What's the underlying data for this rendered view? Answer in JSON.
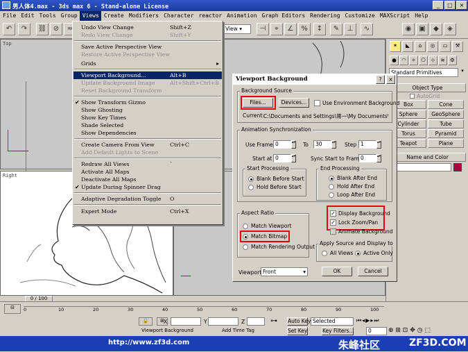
{
  "window": {
    "title": "男人体4.max - 3ds max 6 - Stand-alone License",
    "buttons": [
      "_",
      "□",
      "×"
    ]
  },
  "menubar": [
    "File",
    "Edit",
    "Tools",
    "Group",
    "Views",
    "Create",
    "Modifiers",
    "Character",
    "reactor",
    "Animation",
    "Graph Editors",
    "Rendering",
    "Customize",
    "MAXScript",
    "Help"
  ],
  "toolbar": {
    "view_select": "View"
  },
  "views_menu": {
    "items": [
      {
        "label": "Undo View Change",
        "shortcut": "Shift+Z",
        "state": "normal"
      },
      {
        "label": "Redo View Change",
        "shortcut": "Shift+Y",
        "state": "disabled"
      },
      {
        "label": "Save Active Perspective View",
        "shortcut": "",
        "state": "normal"
      },
      {
        "label": "Restore Active Perspective View",
        "shortcut": "",
        "state": "disabled"
      },
      {
        "label": "Grids",
        "shortcut": "",
        "state": "normal"
      },
      {
        "label": "Viewport Background...",
        "shortcut": "Alt+B",
        "state": "highlighted"
      },
      {
        "label": "Update Background Image",
        "shortcut": "Alt+Shift+Ctrl+B",
        "state": "disabled"
      },
      {
        "label": "Reset Background Transform",
        "shortcut": "",
        "state": "disabled"
      },
      {
        "label": "Show Transform Gizmo",
        "shortcut": "",
        "state": "checked"
      },
      {
        "label": "Show Ghosting",
        "shortcut": "",
        "state": "normal"
      },
      {
        "label": "Show Key Times",
        "shortcut": "",
        "state": "normal"
      },
      {
        "label": "Shade Selected",
        "shortcut": "",
        "state": "normal"
      },
      {
        "label": "Show Dependencies",
        "shortcut": "",
        "state": "normal"
      },
      {
        "label": "Create Camera From View",
        "shortcut": "Ctrl+C",
        "state": "normal"
      },
      {
        "label": "Add Default Lights to Scene",
        "shortcut": "",
        "state": "disabled"
      },
      {
        "label": "Redraw All Views",
        "shortcut": "`",
        "state": "normal"
      },
      {
        "label": "Activate All Maps",
        "shortcut": "",
        "state": "normal"
      },
      {
        "label": "Deactivate All Maps",
        "shortcut": "",
        "state": "normal"
      },
      {
        "label": "Update During Spinner Drag",
        "shortcut": "",
        "state": "checked"
      },
      {
        "label": "Adaptive Degradation Toggle",
        "shortcut": "O",
        "state": "normal"
      },
      {
        "label": "Expert Mode",
        "shortcut": "Ctrl+X",
        "state": "normal"
      }
    ]
  },
  "viewports": {
    "top": "Top",
    "left": "Right"
  },
  "command_panel": {
    "category": "Standard Primitives",
    "object_type": "Object Type",
    "autogrid": "AutoGrid",
    "buttons": [
      "Box",
      "Cone",
      "Sphere",
      "GeoSphere",
      "Cylinder",
      "Tube",
      "Torus",
      "Pyramid",
      "Teapot",
      "Plane"
    ],
    "name_color": "Name and Color"
  },
  "dialog": {
    "title": "Viewport Background",
    "help": "?",
    "close": "×",
    "background_source": {
      "group": "Background Source",
      "files_button": "Files...",
      "devices_button": "Devices...",
      "use_env_label": "Use Environment Background",
      "current_label": "Current:",
      "current_path": "C:\\Documents and Settings\\蒋一\\My Documents\\My"
    },
    "anim_sync": {
      "group": "Animation Synchronization",
      "use_frame_label": "Use Frame",
      "use_frame_value": "0",
      "to_label": "To",
      "to_value": "30",
      "step_label": "Step",
      "step_value": "1",
      "start_at_label": "Start at",
      "start_at_value": "0",
      "sync_label": "Sync Start to Frame",
      "sync_value": "0"
    },
    "start_processing": {
      "group": "Start Processing",
      "options": [
        "Blank Before Start",
        "Hold Before Start"
      ],
      "selected": 0
    },
    "end_processing": {
      "group": "End Processing",
      "options": [
        "Blank After End",
        "Hold After End",
        "Loop After End"
      ],
      "selected": 0
    },
    "aspect_ratio": {
      "group": "Aspect Ratio",
      "options": [
        "Match Viewport",
        "Match Bitmap",
        "Match Rendering Output"
      ],
      "selected": 1
    },
    "display_background": "Display Background",
    "lock_zoom_pan": "Lock Zoom/Pan",
    "animate_background": "Animate Background",
    "apply_source": {
      "group": "Apply Source and Display to",
      "options": [
        "All Views",
        "Active Only"
      ],
      "selected": 1
    },
    "viewport_label": "Viewport:",
    "viewport_value": "Front",
    "ok": "OK",
    "cancel": "Cancel"
  },
  "timeline": {
    "frame_display": "0 / 100",
    "ticks": [
      "0",
      "10",
      "20",
      "30",
      "40",
      "50",
      "60",
      "70",
      "80",
      "90",
      "100"
    ]
  },
  "status": {
    "x_label": "X",
    "y_label": "Y",
    "z_label": "Z",
    "auto_key": "Auto Key",
    "selected": "Selected",
    "set_key": "Set Key",
    "key_filters": "Key Filters...",
    "frame": "0",
    "add_time_tag": "Add Time Tag",
    "prompt": "Viewport Background"
  },
  "watermark": {
    "url": "http://www.zf3d.com",
    "name": "朱峰社区",
    "domain": "ZF3D.COM"
  }
}
